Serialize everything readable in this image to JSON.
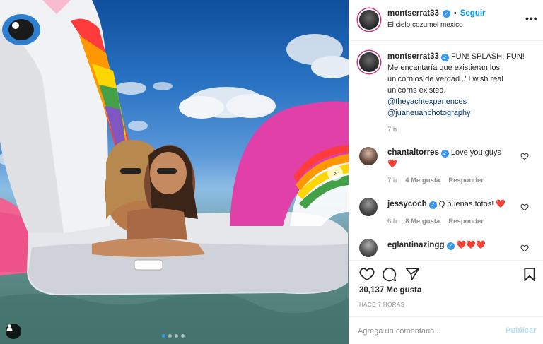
{
  "post": {
    "username": "montserrat33",
    "follow_label": "Seguir",
    "location": "El cielo cozumel mexico",
    "more_label": "•••"
  },
  "caption": {
    "username": "montserrat33",
    "text_line1": "FUN! SPLASH! FUN!",
    "text_line2": "Me encantaría que existieran los",
    "text_line3": "unicornios de verdad. / I wish real",
    "text_line4": "unicorns existed.",
    "mention1": "@theyachtexperiences",
    "mention2": "@juaneuanphotography",
    "time": "7 h"
  },
  "comments": [
    {
      "username": "chantaltorres",
      "text": "Love you guys",
      "emoji": "❤️",
      "time": "7 h",
      "likes": "4 Me gusta",
      "reply": "Responder"
    },
    {
      "username": "jessycoch",
      "text": "Q buenas fotos! ❤️",
      "time": "6 h",
      "likes": "8 Me gusta",
      "reply": "Responder"
    },
    {
      "username": "eglantinazingg",
      "text": "❤️❤️❤️"
    }
  ],
  "stats": {
    "likes": "30,137 Me gusta",
    "time_ago": "HACE 7 HORAS"
  },
  "comment_form": {
    "placeholder": "Agrega un comentario...",
    "publish_label": "Publicar"
  },
  "carousel": {
    "next_glyph": "›",
    "active_index": 0,
    "total": 4
  },
  "colors": {
    "accent": "#0095f6",
    "heart": "#ed4956",
    "verified": "#3897f0"
  },
  "icons": [
    "heart-icon",
    "comment-icon",
    "share-icon",
    "bookmark-icon",
    "more-icon",
    "verified-badge-icon",
    "tagged-users-icon",
    "carousel-next-icon"
  ]
}
